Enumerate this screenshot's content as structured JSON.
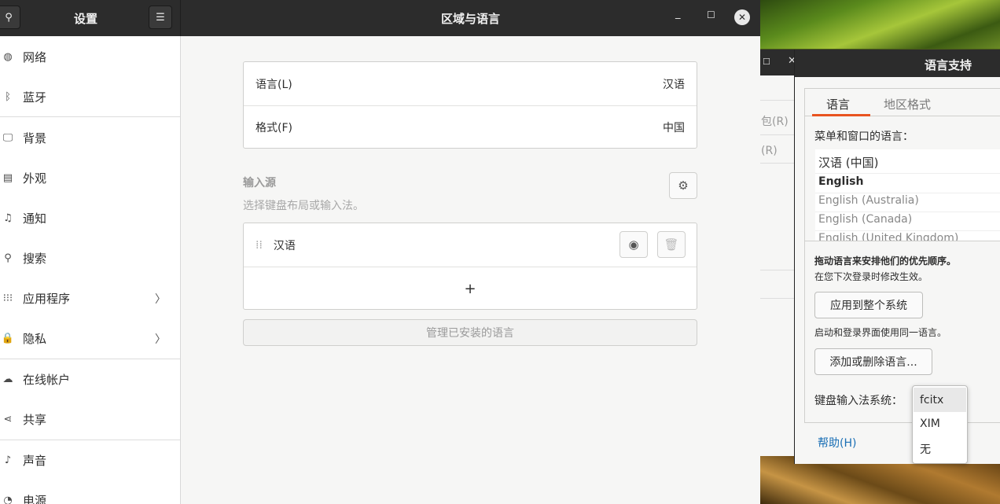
{
  "settings": {
    "title": "设置",
    "window_title": "区域与语言",
    "sidebar": {
      "items": [
        {
          "label": "网络",
          "icon": "globe-icon"
        },
        {
          "label": "蓝牙",
          "icon": "bluetooth-icon"
        },
        {
          "label": "背景",
          "icon": "monitor-icon"
        },
        {
          "label": "外观",
          "icon": "appearance-icon"
        },
        {
          "label": "通知",
          "icon": "bell-icon"
        },
        {
          "label": "搜索",
          "icon": "search-icon"
        },
        {
          "label": "应用程序",
          "icon": "apps-grid-icon"
        },
        {
          "label": "隐私",
          "icon": "lock-icon"
        },
        {
          "label": "在线帐户",
          "icon": "cloud-icon"
        },
        {
          "label": "共享",
          "icon": "share-icon"
        },
        {
          "label": "声音",
          "icon": "music-note-icon"
        },
        {
          "label": "电源",
          "icon": "power-icon"
        }
      ]
    },
    "region": {
      "language_label": "语言(L)",
      "language_value": "汉语",
      "format_label": "格式(F)",
      "format_value": "中国"
    },
    "input_sources": {
      "title": "输入源",
      "subtitle": "选择键盘布局或输入法。",
      "source_name": "汉语",
      "add_symbol": "+",
      "manage_button": "管理已安装的语言"
    }
  },
  "behind_window": {
    "items": [
      "包(R)",
      "(R)"
    ]
  },
  "language_support": {
    "title": "语言支持",
    "tabs": [
      "语言",
      "地区格式"
    ],
    "active_tab": 0,
    "menu_language_label": "菜单和窗口的语言：",
    "languages": [
      "汉语 (中国)",
      "English",
      "English (Australia)",
      "English (Canada)",
      "English (United Kingdom)"
    ],
    "drag_hint_bold": "拖动语言来安排他们的优先顺序。",
    "drag_hint": "在您下次登录时修改生效。",
    "apply_button": "应用到整个系统",
    "login_hint": "启动和登录界面使用同一语言。",
    "add_remove_button": "添加或删除语言...",
    "keyboard_im_label": "键盘输入法系统：",
    "help_link": "帮助(H)",
    "im_options": [
      "fcitx",
      "XIM",
      "无"
    ],
    "im_selected": "fcitx"
  }
}
